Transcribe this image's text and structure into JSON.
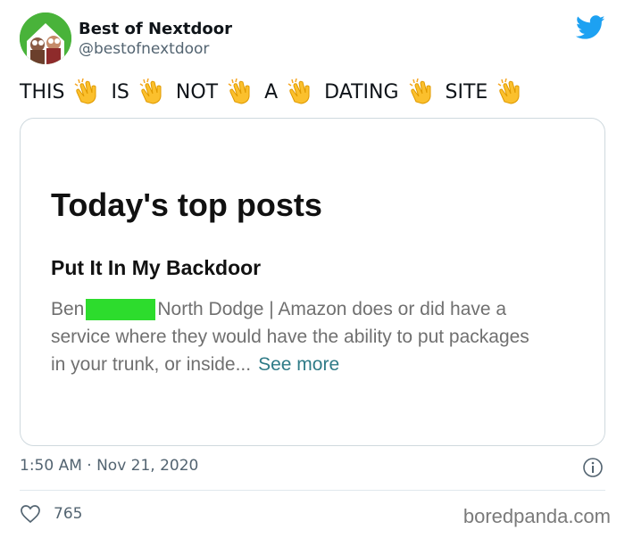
{
  "author": {
    "name": "Best of Nextdoor",
    "handle": "@bestofnextdoor"
  },
  "tweet": {
    "words": [
      "THIS",
      "IS",
      "NOT",
      "A",
      "DATING",
      "SITE"
    ],
    "emoji": "clapping-hands"
  },
  "card": {
    "heading": "Today's top posts",
    "post_title": "Put It In My Backdoor",
    "author_first": "Ben",
    "line1_rest": "North Dodge | Amazon does or did have a",
    "line2": "service where they would have the ability to put packages",
    "line3": "in your trunk, or inside...",
    "see_more": "See more"
  },
  "footer": {
    "timestamp": "1:50 AM · Nov 21, 2020",
    "likes": "765",
    "watermark": "boredpanda.com"
  },
  "colors": {
    "brand": "#1da1f2",
    "redaction": "#2ddc2d",
    "link": "#2f7b87"
  }
}
